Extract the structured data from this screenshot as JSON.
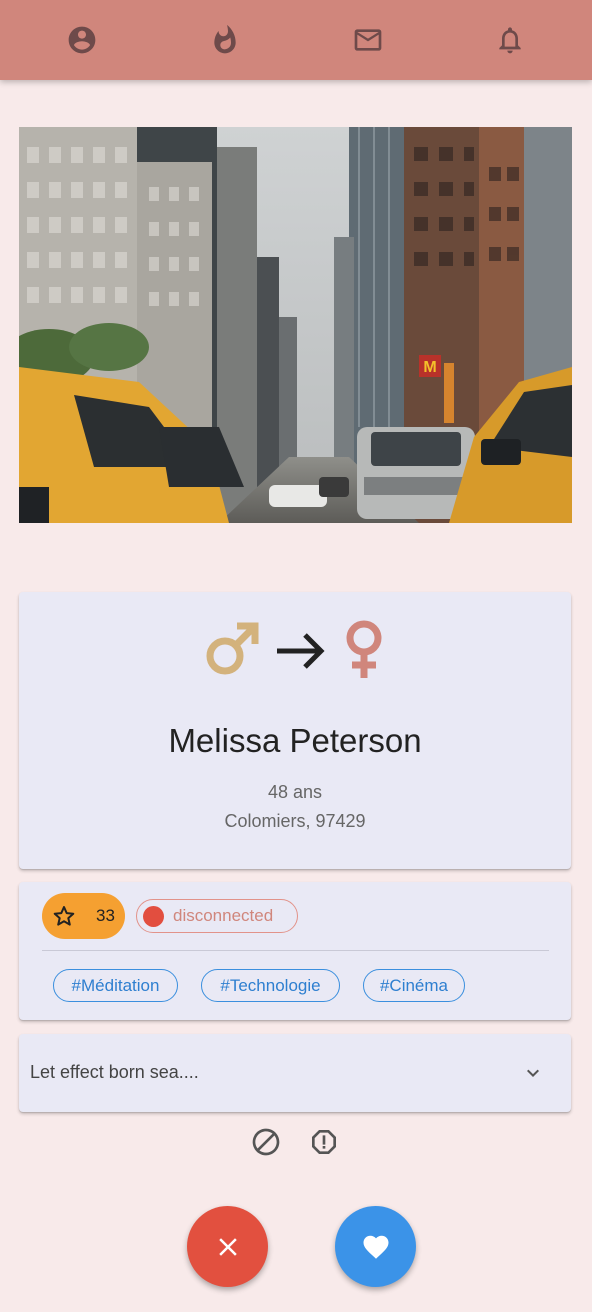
{
  "nav": {
    "items": [
      {
        "icon": "account-circle-icon"
      },
      {
        "icon": "flame-icon"
      },
      {
        "icon": "mail-icon"
      },
      {
        "icon": "bell-icon"
      }
    ],
    "bar_color": "#d0867c"
  },
  "photo": {
    "subject": "city street with yellow taxis and skyscrapers"
  },
  "profile": {
    "gender_icon": "male-icon",
    "arrow_icon": "arrow-right-icon",
    "preference_icon": "female-icon",
    "name": "Melissa Peterson",
    "age": "48 ans",
    "location": "Colomiers, 97429"
  },
  "stats": {
    "score_icon": "star-icon",
    "score": "33",
    "status": "disconnected",
    "status_color": "#e24e3f"
  },
  "tags": [
    "#Méditation",
    "#Technologie",
    "#Cinéma"
  ],
  "bio": {
    "preview": "Let effect born sea....",
    "expand_icon": "chevron-down-icon"
  },
  "actions": {
    "block_icon": "block-icon",
    "report_icon": "report-icon",
    "dislike_icon": "close-icon",
    "like_icon": "heart-icon",
    "dislike_color": "#e2503f",
    "like_color": "#3b93e8"
  }
}
